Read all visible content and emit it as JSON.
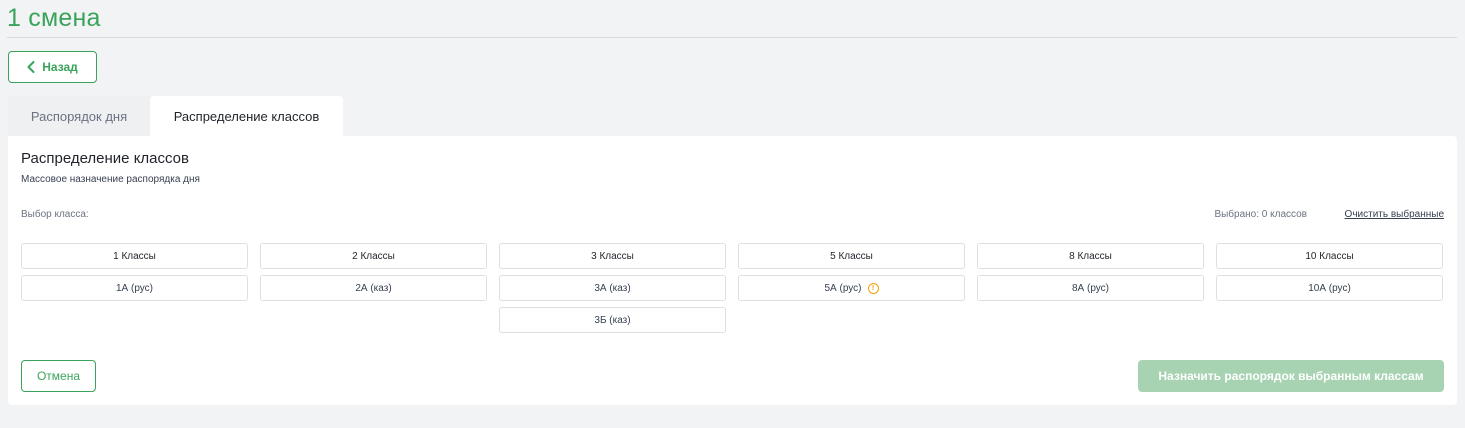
{
  "page": {
    "title": "1 смена"
  },
  "back_button": {
    "label": "Назад",
    "icon": "chevron-left-icon"
  },
  "tabs": [
    {
      "label": "Распорядок дня",
      "active": false
    },
    {
      "label": "Распределение классов",
      "active": true
    }
  ],
  "card": {
    "title": "Распределение классов",
    "subtitle": "Массовое назначение распорядка дня",
    "select_label": "Выбор класса:",
    "selected_count": "Выбрано: 0 классов",
    "clear_link": "Очистить выбранные"
  },
  "groups": [
    {
      "header": "1 Классы",
      "items": [
        "1А (рус)"
      ]
    },
    {
      "header": "2 Классы",
      "items": [
        "2А (каз)"
      ]
    },
    {
      "header": "3 Классы",
      "items": [
        "3А (каз)",
        "3Б (каз)"
      ]
    },
    {
      "header": "5 Классы",
      "items": [
        "5А (рус)"
      ],
      "warning_item": 0
    },
    {
      "header": "8 Классы",
      "items": [
        "8А (рус)"
      ]
    },
    {
      "header": "10 Классы",
      "items": [
        "10А (рус)"
      ]
    }
  ],
  "actions": {
    "cancel_label": "Отмена",
    "assign_label": "Назначить распорядок выбранным классам",
    "assign_disabled": true
  },
  "colors": {
    "accent": "#3aa35b",
    "disabled_button": "#a7d3b3",
    "warning": "#f59e0b"
  }
}
